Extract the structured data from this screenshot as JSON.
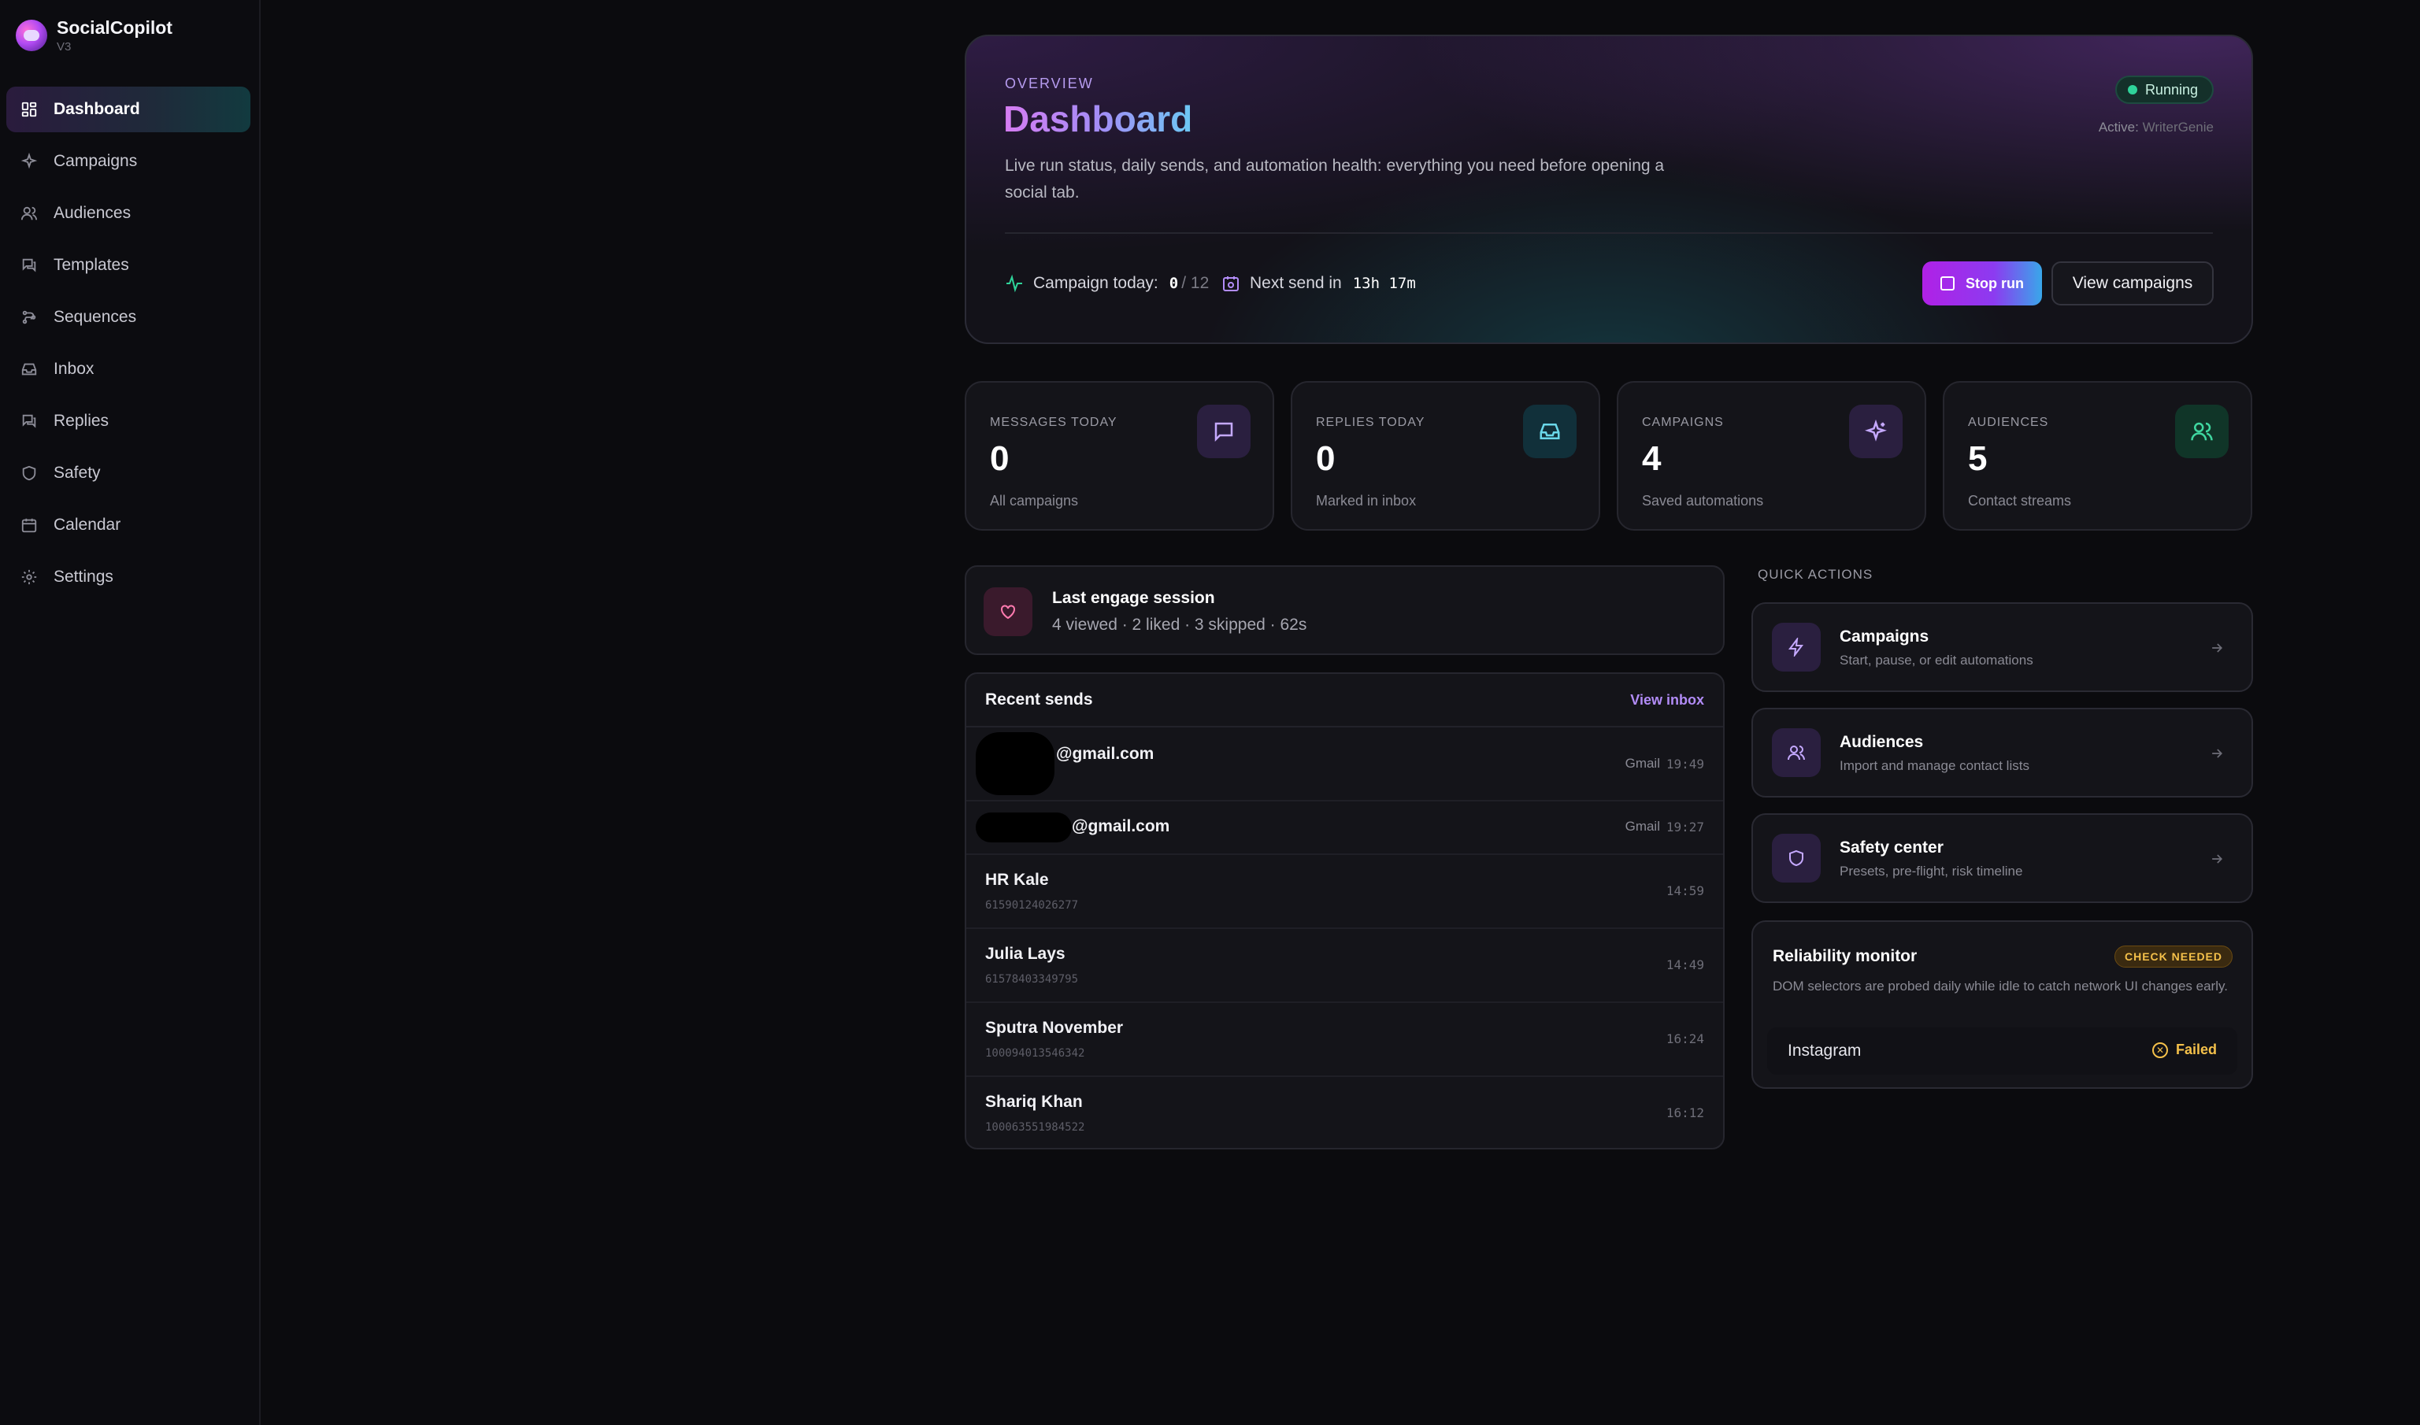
{
  "app": {
    "name": "SocialCopilot",
    "version": "V3"
  },
  "sidebar": {
    "items": [
      {
        "label": "Dashboard",
        "icon": "grid-icon",
        "active": true
      },
      {
        "label": "Campaigns",
        "icon": "sparkles-icon"
      },
      {
        "label": "Audiences",
        "icon": "users-icon"
      },
      {
        "label": "Templates",
        "icon": "chat-icon"
      },
      {
        "label": "Sequences",
        "icon": "flow-icon"
      },
      {
        "label": "Inbox",
        "icon": "inbox-icon"
      },
      {
        "label": "Replies",
        "icon": "reply-icon"
      },
      {
        "label": "Safety",
        "icon": "shield-icon"
      },
      {
        "label": "Calendar",
        "icon": "calendar-icon"
      },
      {
        "label": "Settings",
        "icon": "gear-icon"
      }
    ]
  },
  "hero": {
    "eyebrow": "OVERVIEW",
    "title": "Dashboard",
    "description": "Live run status, daily sends, and automation health: everything you need before opening a social tab.",
    "status": "Running",
    "active_label": "Active:",
    "active_value": "WriterGenie",
    "campaign_today_label": "Campaign today:",
    "campaign_today_value": "0",
    "campaign_today_total": "/ 12",
    "next_send_label": "Next send in",
    "next_send_value": "13h 17m",
    "stop_button": "Stop run",
    "view_button": "View campaigns"
  },
  "stats": [
    {
      "label": "MESSAGES TODAY",
      "value": "0",
      "sub": "All campaigns",
      "icon": "message-icon",
      "color": "#b28cf7"
    },
    {
      "label": "REPLIES TODAY",
      "value": "0",
      "sub": "Marked in inbox",
      "icon": "inbox-icon",
      "color": "#4fd1e0"
    },
    {
      "label": "CAMPAIGNS",
      "value": "4",
      "sub": "Saved automations",
      "icon": "sparkles-icon",
      "color": "#b28cf7"
    },
    {
      "label": "AUDIENCES",
      "value": "5",
      "sub": "Contact streams",
      "icon": "users-icon",
      "color": "#3fd7a0"
    }
  ],
  "engage": {
    "title": "Last engage session",
    "summary": "4 viewed · 2 liked · 3 skipped · 62s"
  },
  "recent": {
    "title": "Recent sends",
    "link": "View inbox",
    "rows": [
      {
        "name": "@gmail.com",
        "sub": "",
        "source": "Gmail",
        "time": "19:49"
      },
      {
        "name": "@gmail.com",
        "sub": "",
        "source": "Gmail",
        "time": "19:27"
      },
      {
        "name": "HR Kale",
        "sub": "61590124026277",
        "source": "",
        "time": "14:59"
      },
      {
        "name": "Julia Lays",
        "sub": "61578403349795",
        "source": "",
        "time": "14:49"
      },
      {
        "name": "Sputra November",
        "sub": "100094013546342",
        "source": "",
        "time": "16:24"
      },
      {
        "name": "Shariq Khan",
        "sub": "100063551984522",
        "source": "",
        "time": "16:12"
      }
    ]
  },
  "quick_actions": {
    "label": "QUICK ACTIONS",
    "items": [
      {
        "title": "Campaigns",
        "sub": "Start, pause, or edit automations",
        "icon": "bolt-icon"
      },
      {
        "title": "Audiences",
        "sub": "Import and manage contact lists",
        "icon": "users-icon"
      },
      {
        "title": "Safety center",
        "sub": "Presets, pre-flight, risk timeline",
        "icon": "shield-icon"
      }
    ]
  },
  "reliability": {
    "title": "Reliability monitor",
    "badge": "CHECK NEEDED",
    "description": "DOM selectors are probed daily while idle to catch network UI changes early.",
    "network": "Instagram",
    "status": "Failed"
  }
}
